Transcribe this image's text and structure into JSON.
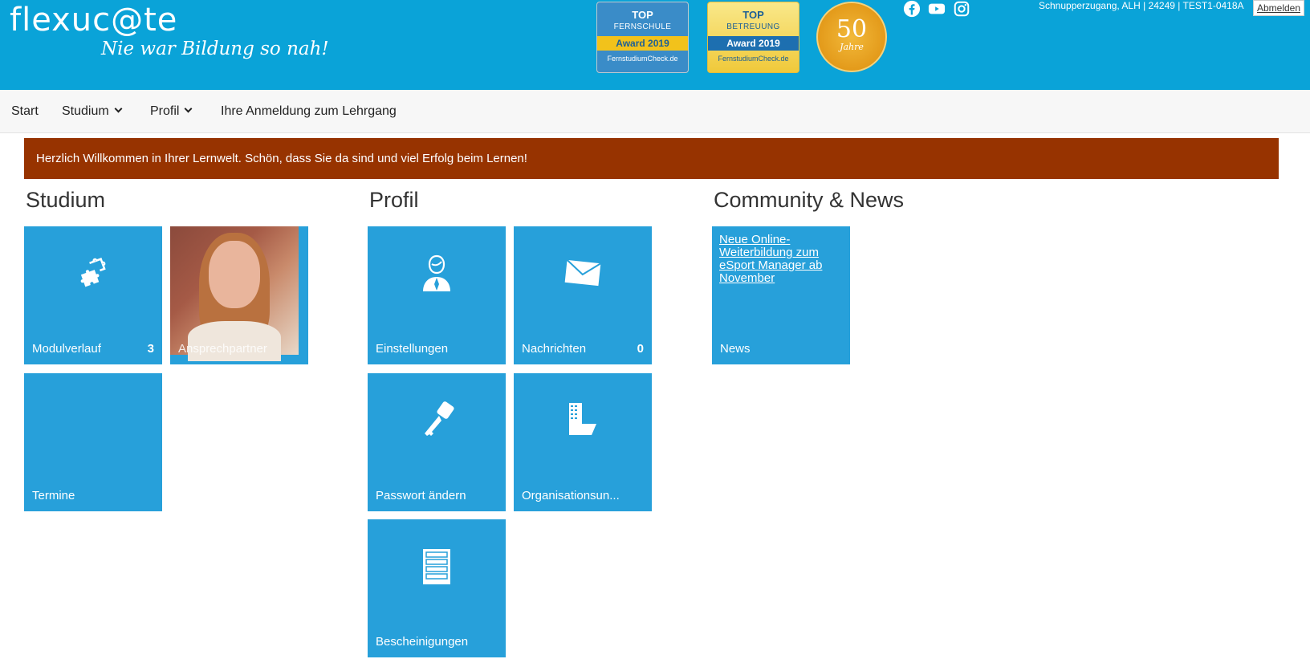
{
  "header": {
    "logo_text": "flexuc@te",
    "tagline": "Nie war Bildung so nah!",
    "badges": [
      {
        "top": "TOP",
        "sub": "FERNSCHULE",
        "award": "Award 2019",
        "site": "FernstudiumCheck.de"
      },
      {
        "top": "TOP",
        "sub": "BETREUUNG",
        "award": "Award 2019",
        "site": "FernstudiumCheck.de"
      }
    ],
    "seal": {
      "number": "50",
      "text": "Jahre"
    },
    "social_icons": [
      "facebook-icon",
      "youtube-icon",
      "instagram-icon"
    ],
    "user_info": "Schnupperzugang, ALH | 24249 | TEST1-0418A",
    "logout_label": "Abmelden",
    "colors": {
      "header_bg": "#0aa3d8",
      "tile_bg": "#27a0da",
      "welcome_bg": "#973300"
    }
  },
  "nav": {
    "items": [
      {
        "label": "Start",
        "dropdown": false
      },
      {
        "label": "Studium",
        "dropdown": true
      },
      {
        "label": "Profil",
        "dropdown": true
      },
      {
        "label": "Ihre Anmeldung zum Lehrgang",
        "dropdown": false
      }
    ]
  },
  "welcome": "Herzlich Willkommen in Ihrer Lernwelt. Schön, dass Sie da sind und viel Erfolg beim Lernen!",
  "sections": {
    "studium": {
      "title": "Studium",
      "tiles": [
        {
          "label": "Modulverlauf",
          "count": "3",
          "icon": "puzzle-icon"
        },
        {
          "label": "Ansprechpartner",
          "icon": "contact-photo"
        },
        {
          "label": "Termine"
        }
      ]
    },
    "profil": {
      "title": "Profil",
      "tiles": [
        {
          "label": "Einstellungen",
          "icon": "user-icon"
        },
        {
          "label": "Nachrichten",
          "count": "0",
          "icon": "envelope-icon"
        },
        {
          "label": "Passwort ändern",
          "icon": "key-icon"
        },
        {
          "label": "Organisationsun...",
          "icon": "building-icon"
        },
        {
          "label": "Bescheinigungen",
          "icon": "document-icon"
        }
      ]
    },
    "community": {
      "title": "Community & News",
      "tiles": [
        {
          "label": "News",
          "link": "Neue Online-Weiterbildung zum eSport Manager ab November"
        }
      ]
    }
  }
}
